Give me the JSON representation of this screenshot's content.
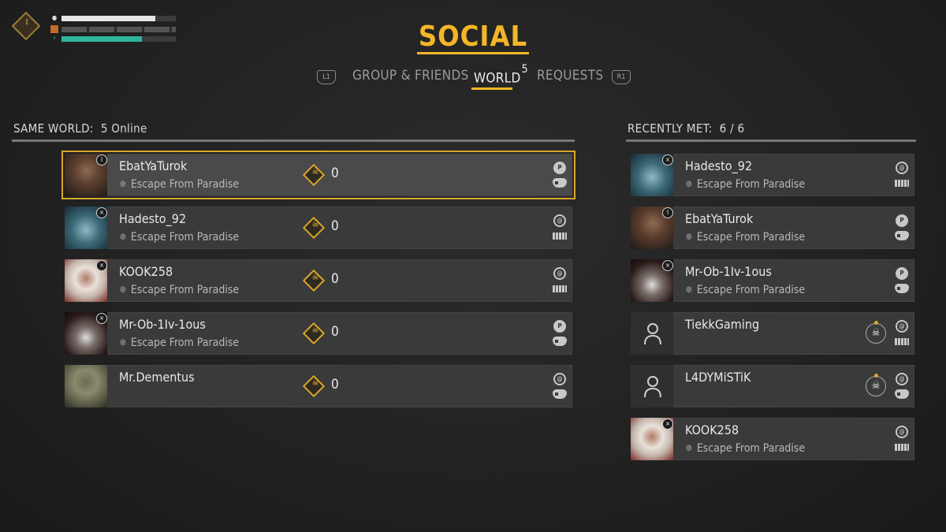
{
  "hud": {
    "level_glyph": "I",
    "health_fraction": 0.82,
    "stamina_fraction": 0.7,
    "icons": [
      "immunity-icon",
      "weapon-icon",
      "lightning-icon"
    ]
  },
  "header": {
    "title": "SOCIAL",
    "tabs": [
      {
        "label": "GROUP & FRIENDS",
        "active": false
      },
      {
        "label": "WORLD",
        "count": "5",
        "active": true
      },
      {
        "label": "REQUESTS",
        "active": false
      }
    ],
    "left_bumper": "L1",
    "right_bumper": "R1"
  },
  "same_world": {
    "heading_label": "SAME WORLD:",
    "heading_value": "5 Online",
    "players": [
      {
        "name": "EbatYaTurok",
        "world": "Escape From Paradise",
        "rank": "0",
        "platform": "ps",
        "input": "pad",
        "avatar": "woman",
        "badge": "i"
      },
      {
        "name": "Hadesto_92",
        "world": "Escape From Paradise",
        "rank": "0",
        "platform": "ubi",
        "input": "kbd",
        "avatar": "skull-blue",
        "badge": "run"
      },
      {
        "name": "KOOK258",
        "world": "Escape From Paradise",
        "rank": "0",
        "platform": "ubi",
        "input": "kbd",
        "avatar": "hood-white",
        "badge": "run"
      },
      {
        "name": "Mr-Ob-1Iv-1ous",
        "world": "Escape From Paradise",
        "rank": "0",
        "platform": "ps",
        "input": "pad",
        "avatar": "skull-red",
        "badge": "run"
      },
      {
        "name": "Mr.Dementus",
        "world": "",
        "rank": "0",
        "platform": "ubi",
        "input": "pad",
        "avatar": "hood-green",
        "badge": ""
      }
    ]
  },
  "recently_met": {
    "heading_label": "RECENTLY MET:",
    "heading_value": "6 / 6",
    "players": [
      {
        "name": "Hadesto_92",
        "world": "Escape From Paradise",
        "platform": "ubi",
        "input": "kbd",
        "avatar": "skull-blue",
        "badge": "run"
      },
      {
        "name": "EbatYaTurok",
        "world": "Escape From Paradise",
        "platform": "ps",
        "input": "pad",
        "avatar": "woman",
        "badge": "i"
      },
      {
        "name": "Mr-Ob-1Iv-1ous",
        "world": "Escape From Paradise",
        "platform": "ps",
        "input": "pad",
        "avatar": "skull-red",
        "badge": "run"
      },
      {
        "name": "TiekkGaming",
        "world": "",
        "platform": "ubi",
        "input": "kbd",
        "avatar": "empty",
        "badge": "",
        "skull": true
      },
      {
        "name": "L4DYMiSTiK",
        "world": "",
        "platform": "ubi",
        "input": "pad",
        "avatar": "empty",
        "badge": "",
        "skull": true
      },
      {
        "name": "KOOK258",
        "world": "Escape From Paradise",
        "platform": "ubi",
        "input": "kbd",
        "avatar": "hood-white",
        "badge": "run"
      }
    ]
  },
  "colors": {
    "accent": "#f2b627",
    "card_bg": "#3a3a3a",
    "selected_outline": "#d8a82a"
  }
}
